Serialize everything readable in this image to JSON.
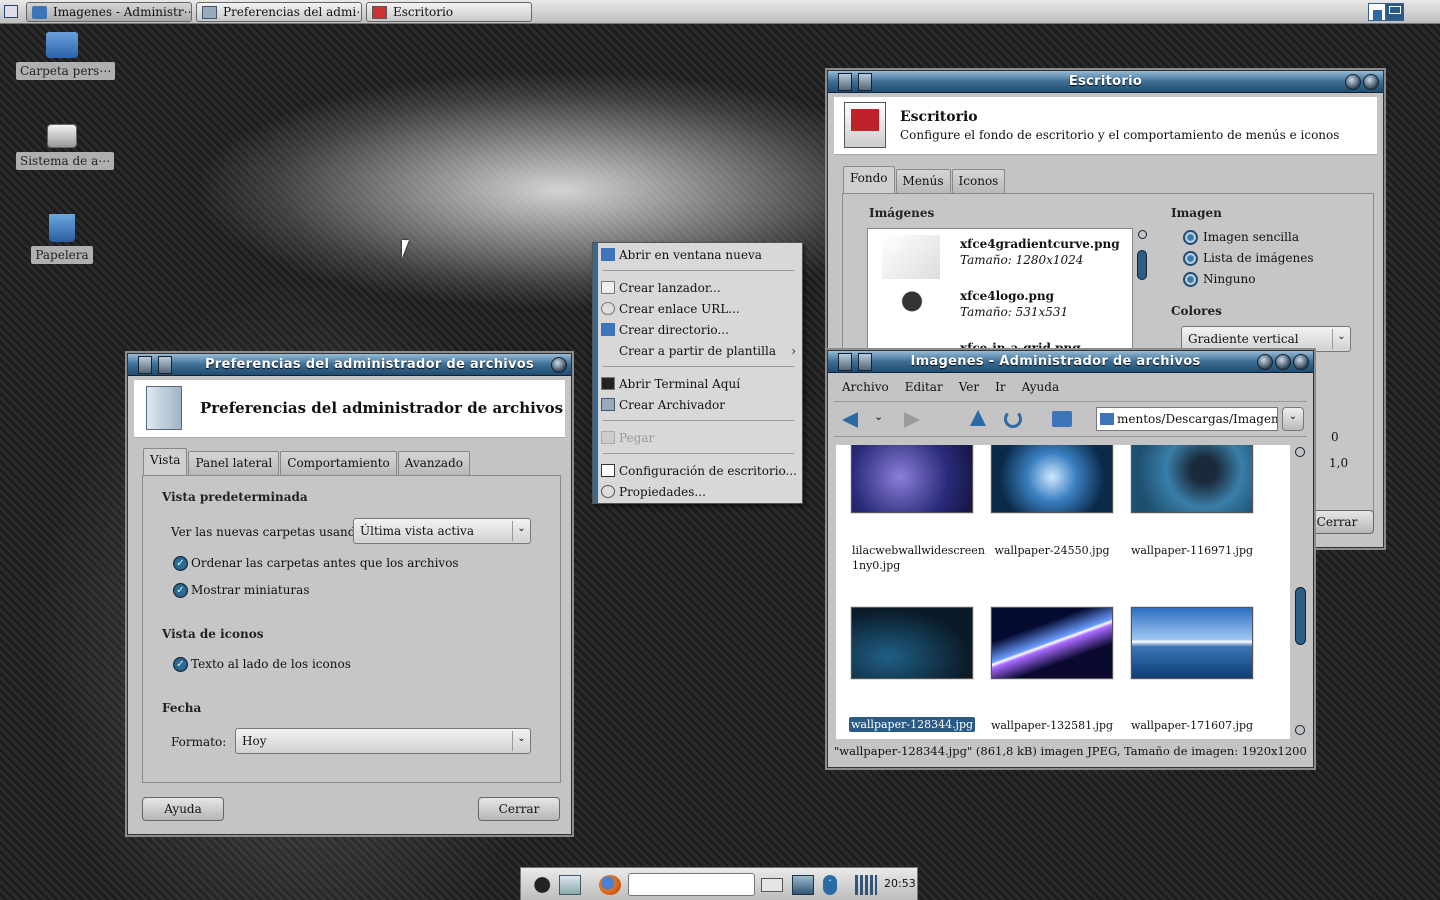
{
  "taskbar": {
    "tasks": [
      "Imagenes - Administr⋯",
      "Preferencias del admi⋯",
      "Escritorio"
    ]
  },
  "desktop": {
    "icons": [
      "Carpeta pers⋯",
      "Sistema de a⋯",
      "Papelera"
    ]
  },
  "prefs": {
    "title": "Preferencias del administrador de archivos",
    "header": "Preferencias del administrador de archivos",
    "tabs": [
      "Vista",
      "Panel lateral",
      "Comportamiento",
      "Avanzado"
    ],
    "sec_default": "Vista predeterminada",
    "new_folders_label": "Ver las nuevas carpetas usando:",
    "new_folders_value": "Última vista activa",
    "sort_folders": "Ordenar las carpetas antes que los archivos",
    "show_thumbs": "Mostrar miniaturas",
    "sec_icons": "Vista de iconos",
    "text_beside": "Texto al lado de los iconos",
    "sec_date": "Fecha",
    "format_label": "Formato:",
    "format_value": "Hoy",
    "help": "Ayuda",
    "close": "Cerrar"
  },
  "context_menu": {
    "items": [
      "Abrir en ventana nueva",
      "Crear lanzador...",
      "Crear enlace URL...",
      "Crear directorio...",
      "Crear a partir de plantilla",
      "Abrir Terminal Aquí",
      "Crear Archivador",
      "Pegar",
      "Configuración de escritorio...",
      "Propiedades..."
    ]
  },
  "desk": {
    "title": "Escritorio",
    "header_title": "Escritorio",
    "header_sub": "Configure el fondo de escritorio y el comportamiento de menús e iconos",
    "tabs": [
      "Fondo",
      "Menús",
      "Iconos"
    ],
    "images_label": "Imágenes",
    "images": [
      {
        "name": "xfce4gradientcurve.png",
        "size": "Tamaño: 1280x1024"
      },
      {
        "name": "xfce4logo.png",
        "size": "Tamaño: 531x531"
      },
      {
        "name": "xfce-in-a-grid.png",
        "size": ""
      }
    ],
    "imagen_label": "Imagen",
    "radios": [
      "Imagen sencilla",
      "Lista de imágenes",
      "Ninguno"
    ],
    "colores_label": "Colores",
    "colores_value": "Gradiente vertical",
    "v0": "0",
    "v1": "1,0",
    "close": "Cerrar"
  },
  "fm": {
    "title": "Imagenes - Administrador de archivos",
    "menus": [
      "Archivo",
      "Editar",
      "Ver",
      "Ir",
      "Ayuda"
    ],
    "path": "mentos/Descargas/Imagenes",
    "files": [
      "lilacwebwallwidescreen1ny0.jpg",
      "wallpaper-24550.jpg",
      "wallpaper-116971.jpg",
      "wallpaper-128344.jpg",
      "wallpaper-132581.jpg",
      "wallpaper-171607.jpg"
    ],
    "status": "\"wallpaper-128344.jpg\" (861,8 kB) imagen JPEG, Tamaño de imagen: 1920x1200"
  },
  "clock": "20:53"
}
